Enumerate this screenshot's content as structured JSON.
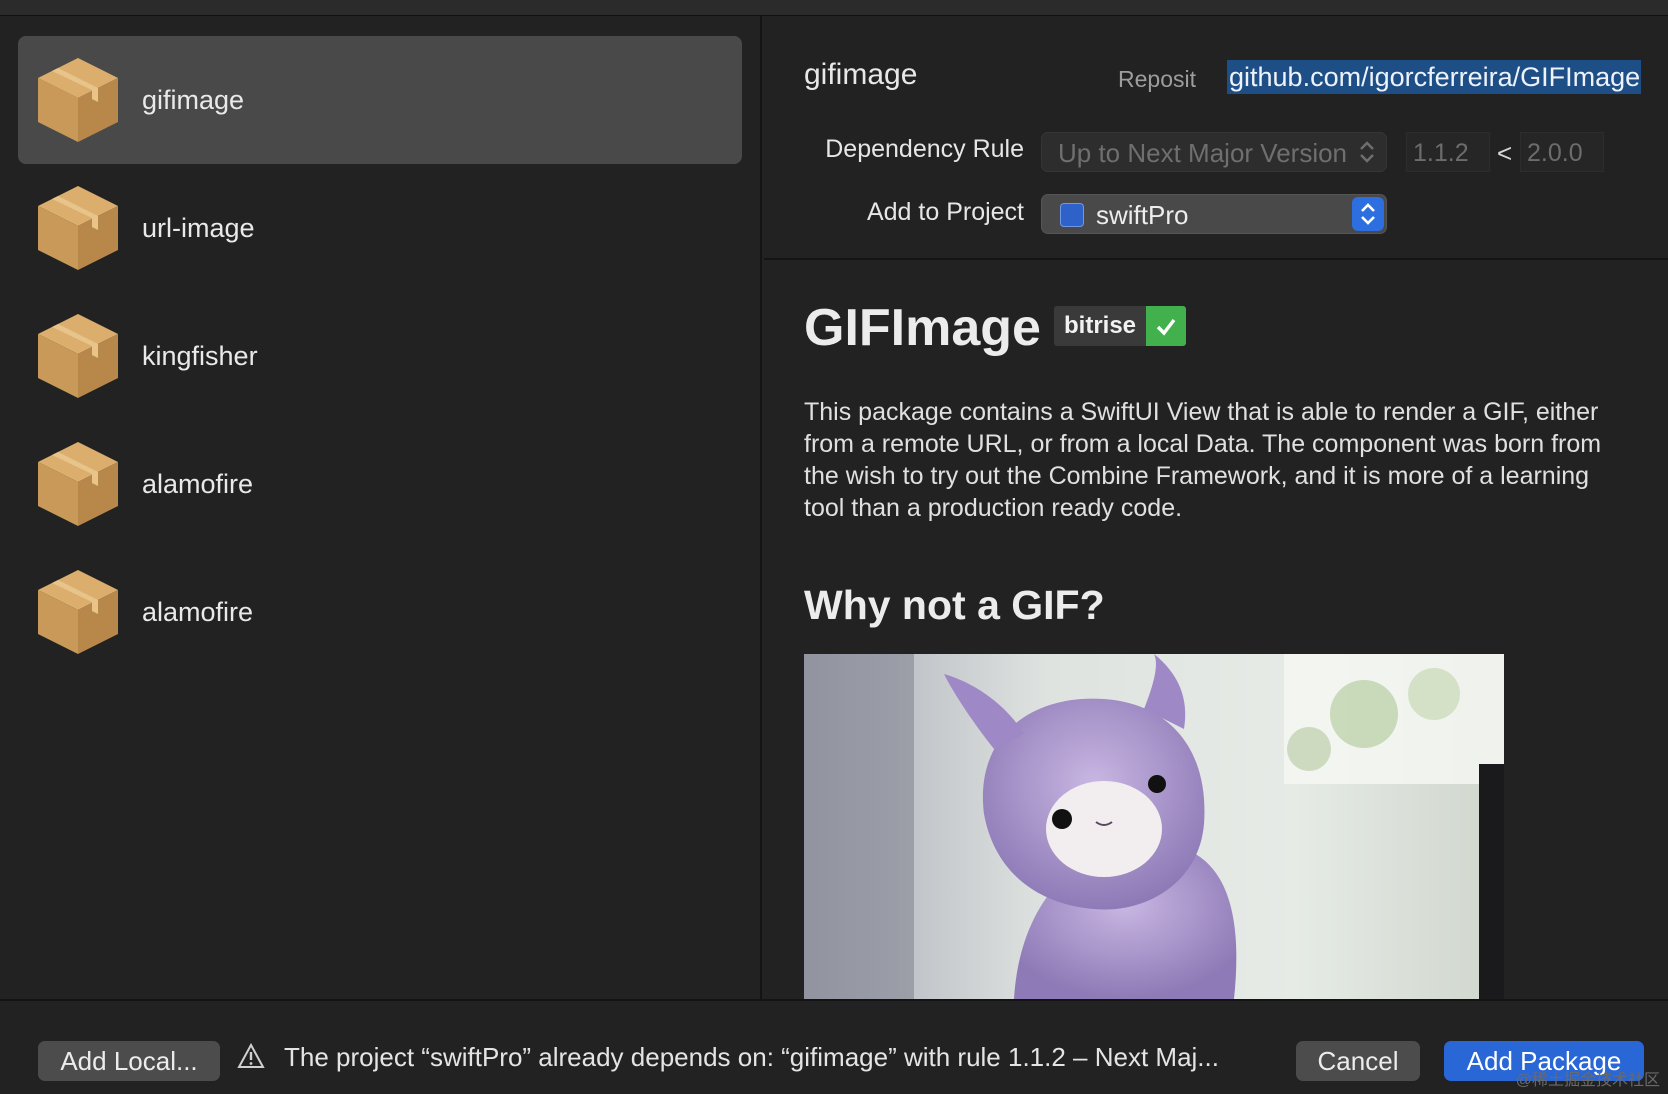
{
  "packages": [
    {
      "name": "gifimage",
      "selected": true
    },
    {
      "name": "url-image",
      "selected": false
    },
    {
      "name": "kingfisher",
      "selected": false
    },
    {
      "name": "alamofire",
      "selected": false
    },
    {
      "name": "alamofire",
      "selected": false
    }
  ],
  "detail": {
    "package_name": "gifimage",
    "repository_label": "Reposit",
    "repository_url": "github.com/igorcferreira/GIFImage",
    "dependency_rule_label": "Dependency Rule",
    "dependency_rule_value": "Up to Next Major Version",
    "version_min": "1.1.2",
    "version_separator": "<",
    "version_max": "2.0.0",
    "add_to_project_label": "Add to Project",
    "project_value": "swiftPro"
  },
  "readme": {
    "title": "GIFImage",
    "badge_label": "bitrise",
    "paragraph": "This package contains a SwiftUI View that is able to render a GIF, either from a remote URL, or from a local Data. The component was born from the wish to try out the Combine Framework, and it is more of a learning tool than a production ready code.",
    "heading2": "Why not a GIF?"
  },
  "footer": {
    "add_local_label": "Add Local...",
    "warning_text": "The project “swiftPro” already depends on: “gifimage” with rule 1.1.2 – Next Maj...",
    "cancel_label": "Cancel",
    "add_package_label": "Add Package"
  },
  "watermark": "@稀土掘金技术社区",
  "colors": {
    "accent": "#2966d6",
    "selection": "#1d4f86",
    "badge_green": "#41b04d",
    "package_icon": "#c9995a"
  }
}
